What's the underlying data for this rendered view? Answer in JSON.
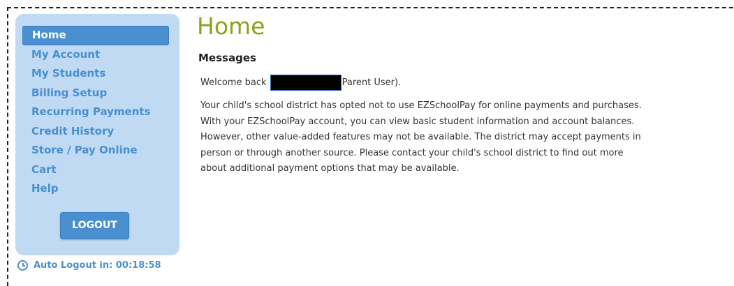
{
  "sidebar": {
    "items": [
      {
        "label": "Home",
        "active": true
      },
      {
        "label": "My Account"
      },
      {
        "label": "My Students"
      },
      {
        "label": "Billing Setup"
      },
      {
        "label": "Recurring Payments"
      },
      {
        "label": "Credit History"
      },
      {
        "label": "Store / Pay Online"
      },
      {
        "label": "Cart"
      },
      {
        "label": "Help"
      }
    ],
    "logout_label": "LOGOUT",
    "auto_logout": "Auto Logout in: 00:18:58"
  },
  "main": {
    "title": "Home",
    "messages_heading": "Messages",
    "welcome_prefix": "Welcome back",
    "welcome_suffix": "Parent User).",
    "body_lines": [
      "Your child's school district has opted not to use EZSchoolPay for online payments and purchases.",
      "With your EZSchoolPay account, you can view basic student information and account balances.",
      "However, other value-added features may not be available. The district may accept payments in",
      "person or through another source. Please contact your child's school district to find out more",
      "about additional payment options that may be available."
    ]
  },
  "colors": {
    "sidebar_bg": "#bfdaf2",
    "accent": "#4a8fd0",
    "title": "#8aa31c"
  },
  "icons": {
    "clock": "clock-icon"
  }
}
